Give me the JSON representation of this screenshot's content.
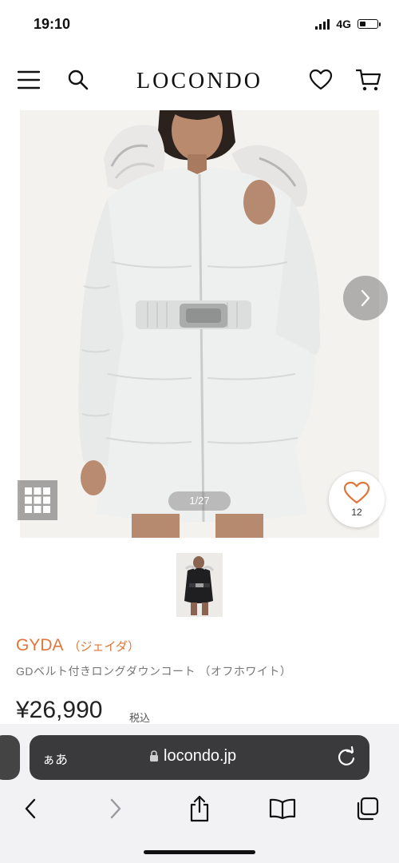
{
  "status_bar": {
    "time": "19:10",
    "network": "4G",
    "battery_level": 0.3
  },
  "header": {
    "logo": "LOCONDO",
    "icons": [
      "menu-icon",
      "search-icon",
      "heart-icon",
      "cart-icon"
    ]
  },
  "product_image": {
    "counter": "1/27",
    "favorite_count": "12",
    "icons": [
      "chevron-right-icon",
      "grid-icon",
      "heart-outline-icon"
    ]
  },
  "product": {
    "brand": "GYDA",
    "brand_kana": "（ジェイダ）",
    "name": "GDベルト付きロングダウンコート （オフホワイト）",
    "price": "¥26,990",
    "tax_label": "税込"
  },
  "browser": {
    "aa_label": "ぁあ",
    "url": "locondo.jp",
    "toolbar_icons": [
      "back-icon",
      "forward-icon",
      "share-icon",
      "bookmarks-icon",
      "tabs-icon"
    ]
  },
  "colors": {
    "brand_accent": "#e0753a",
    "url_bar": "#3a3a3c"
  }
}
